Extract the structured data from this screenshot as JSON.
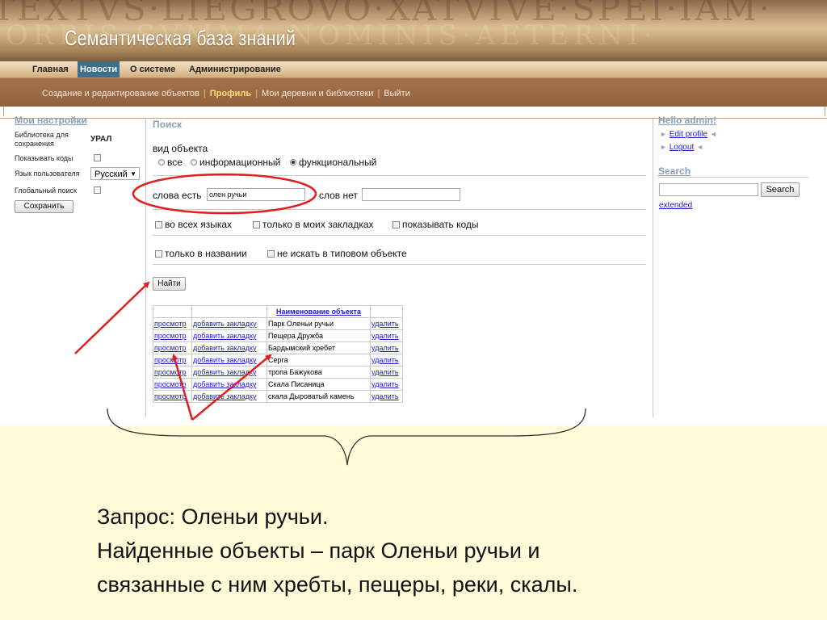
{
  "site": {
    "title": "Семантическая база знаний"
  },
  "main_nav": [
    {
      "label": "Главная",
      "active": false
    },
    {
      "label": "Новости",
      "active": true
    },
    {
      "label": "О системе",
      "active": false
    },
    {
      "label": "Администрирование",
      "active": false
    }
  ],
  "sub_nav": [
    {
      "label": "Создание и редактирование объектов",
      "active": false
    },
    {
      "label": "Профиль",
      "active": true
    },
    {
      "label": "Мои деревни и библиотеки",
      "active": false
    },
    {
      "label": "Выйти",
      "active": false
    }
  ],
  "sub_nav_separator": "|",
  "settings": {
    "title": "Мои настройки",
    "library_label": "Библиотека для сохранения",
    "library_value": "УРАЛ",
    "show_codes_label": "Показывать коды",
    "language_label": "Язык пользователя",
    "language_value": "Русский",
    "global_search_label": "Глобальный поиск",
    "save_button": "Сохранить"
  },
  "search": {
    "title": "Поиск",
    "object_type_label": "вид объекта",
    "radio_all": "все",
    "radio_informational": "информационный",
    "radio_functional": "функциональный",
    "selected_type": "функциональный",
    "words_yes_label": "слова есть",
    "words_yes_value": "олен ручьи",
    "words_no_label": "слов нет",
    "words_no_value": "",
    "opt_all_languages": "во всех языках",
    "opt_my_bookmarks": "только в моих закладках",
    "opt_show_codes": "показывать коды",
    "opt_title_only": "только в названии",
    "opt_no_typical": "не искать в типовом объекте",
    "find_button": "Найти"
  },
  "results": {
    "header_name": "Наименование объекта",
    "view_label": "просмотр",
    "bookmark_label": "добавить закладку",
    "delete_label": "удалить",
    "rows": [
      "Парк Оленьи ручьи",
      "Пещера Дружба",
      "Бардымский хребет",
      "Серга",
      "тропа Бажукова",
      "Скала Писаница",
      "скала Дыроватый камень"
    ]
  },
  "sidebar": {
    "greeting": "Hello admin!",
    "edit_profile": "Edit profile",
    "logout": "Logout",
    "search_title": "Search",
    "search_value": "",
    "search_button": "Search",
    "extended": "extended"
  },
  "caption": {
    "line1": "Запрос: Оленьи ручьи.",
    "line2": "Найденные объекты – парк Оленьи ручьи и",
    "line3": "связанные с ним хребты, пещеры, реки, скалы."
  },
  "colors": {
    "annotation_red": "#e02020",
    "header_brown": "#9a6a44",
    "nav_active": "#3f6f8c",
    "link_blue": "#1b1bd0",
    "caption_bg": "#fffbd8"
  }
}
